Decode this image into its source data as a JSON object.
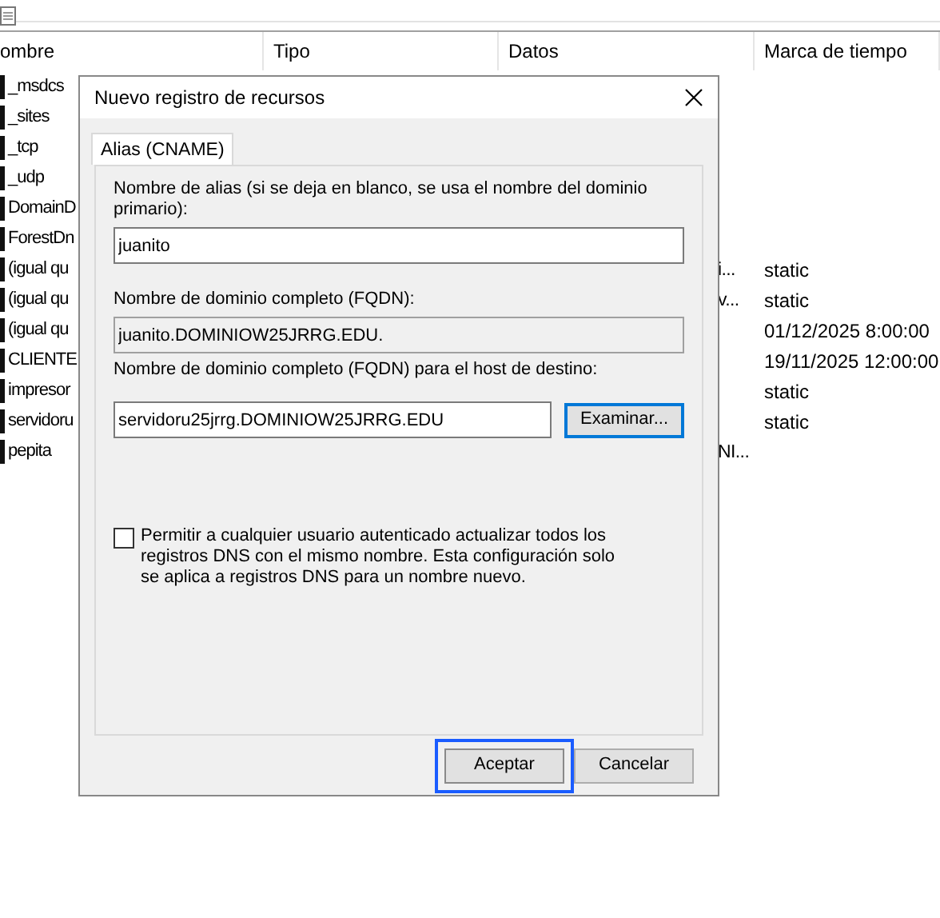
{
  "list": {
    "columns": [
      "ombre",
      "Tipo",
      "Datos",
      "Marca de tiempo"
    ],
    "rows": [
      {
        "name": "_msdcs"
      },
      {
        "name": "_sites"
      },
      {
        "name": "_tcp"
      },
      {
        "name": "_udp"
      },
      {
        "name": "DomainD"
      },
      {
        "name": "ForestDn"
      },
      {
        "name": "(igual qu",
        "data": "i...",
        "timestamp": "static"
      },
      {
        "name": "(igual qu",
        "data": "v...",
        "timestamp": "static"
      },
      {
        "name": "(igual qu",
        "timestamp": "01/12/2025 8:00:00"
      },
      {
        "name": "CLIENTE",
        "timestamp": "19/11/2025 12:00:00"
      },
      {
        "name": "impresor",
        "timestamp": "static"
      },
      {
        "name": "servidoru",
        "timestamp": "static"
      },
      {
        "name": "pepita",
        "data": "NI..."
      }
    ]
  },
  "dialog": {
    "title": "Nuevo registro de recursos",
    "tabs": [
      {
        "label": "Alias (CNAME)",
        "selected": true
      }
    ],
    "alias": {
      "label": "Nombre de alias (si se deja en blanco, se usa el nombre del dominio primario):",
      "value": "juanito"
    },
    "fqdn": {
      "label": "Nombre de dominio completo (FQDN):",
      "value": "juanito.DOMINIOW25JRRG.EDU."
    },
    "target": {
      "label": "Nombre de dominio completo (FQDN) para el host de destino:",
      "value": "servidoru25jrrg.DOMINIOW25JRRG.EDU",
      "browse_button": "Examinar..."
    },
    "checkbox": {
      "label": "Permitir a cualquier usuario autenticado actualizar todos los registros DNS con el mismo nombre. Esta configuración solo se aplica a registros DNS para un nombre nuevo.",
      "checked": false
    },
    "buttons": [
      {
        "label": "Aceptar",
        "focused": true
      },
      {
        "label": "Cancelar",
        "focused": false
      }
    ]
  }
}
